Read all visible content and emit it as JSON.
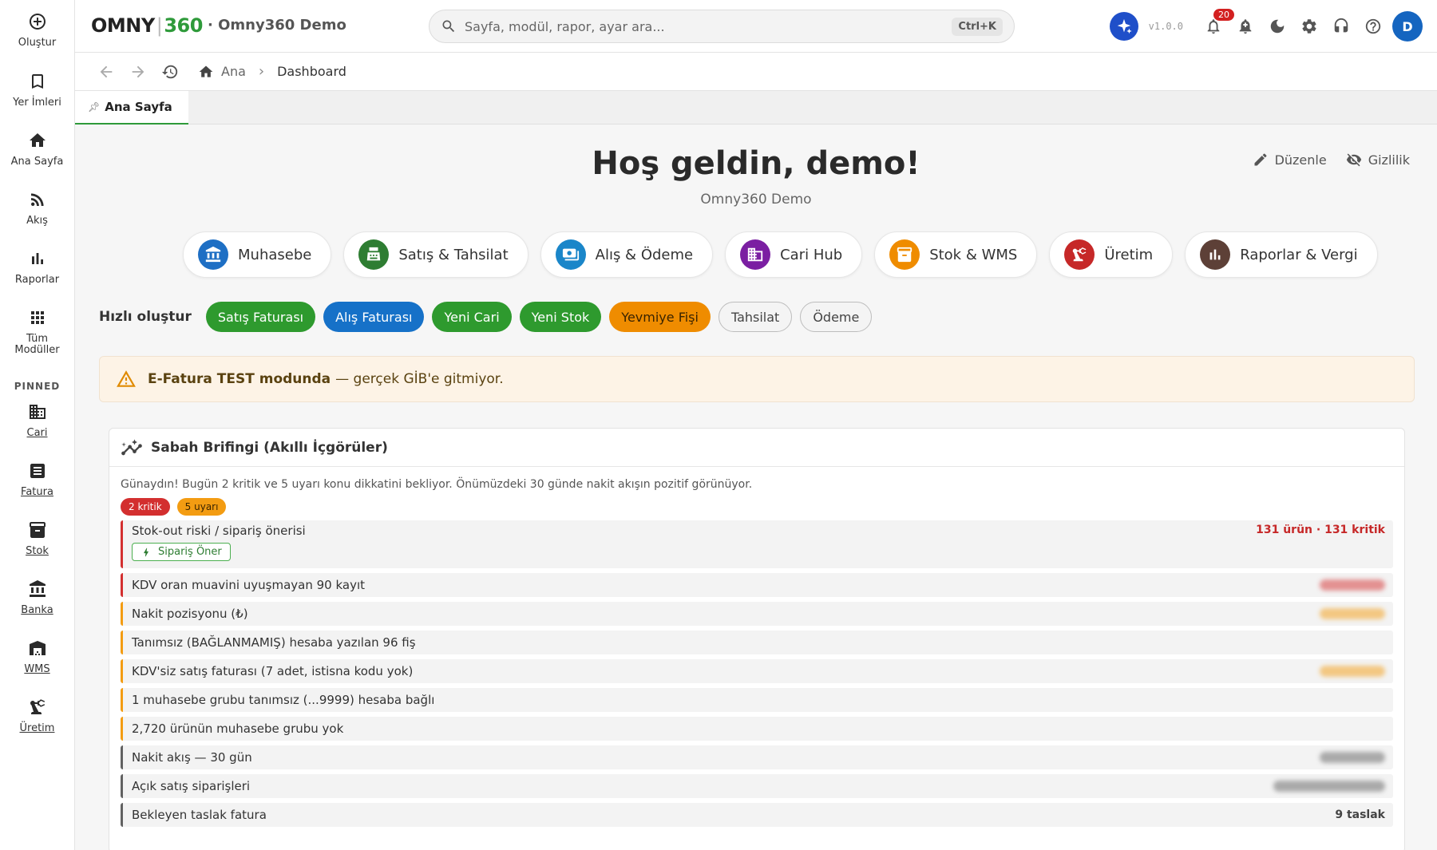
{
  "rail": {
    "items": [
      {
        "label": "Oluştur",
        "icon": "add-circle-icon"
      },
      {
        "label": "Yer İmleri",
        "icon": "bookmark-icon"
      },
      {
        "label": "Ana Sayfa",
        "icon": "home-icon"
      },
      {
        "label": "Akış",
        "icon": "rss-feed-icon"
      },
      {
        "label": "Raporlar",
        "icon": "bar-chart-icon"
      },
      {
        "label": "Tüm Modüller",
        "icon": "apps-grid-icon"
      }
    ],
    "pinned_title": "PINNED",
    "pinned": [
      {
        "label": "Cari",
        "icon": "domain-icon"
      },
      {
        "label": "Fatura",
        "icon": "receipt-icon"
      },
      {
        "label": "Stok",
        "icon": "inventory-icon"
      },
      {
        "label": "Banka",
        "icon": "bank-icon"
      },
      {
        "label": "WMS",
        "icon": "warehouse-icon"
      },
      {
        "label": "Üretim",
        "icon": "precision-manufacturing-icon"
      }
    ]
  },
  "topbar": {
    "brand_a": "OMNY",
    "brand_sep": "|",
    "brand_b": "360",
    "org": "· Omny360 Demo",
    "search_placeholder": "Sayfa, modül, rapor, ayar ara...",
    "search_shortcut": "Ctrl+K",
    "version": "v1.0.0",
    "notifications_count": "20",
    "avatar": "D",
    "colors": {
      "brand_green": "#2e9a3a",
      "ai_blue": "#1f4fc9",
      "avatar_blue": "#1565c0",
      "badge_red": "#d32020"
    }
  },
  "breadcrumb": {
    "home": "Ana",
    "current": "Dashboard"
  },
  "tabs": [
    {
      "label": "Ana Sayfa",
      "active": true
    }
  ],
  "main": {
    "welcome": "Hoş geldin, demo!",
    "subtitle": "Omny360 Demo",
    "edit_label": "Düzenle",
    "privacy_label": "Gizlilik",
    "modules": [
      {
        "label": "Muhasebe",
        "color": "#1e6fc4",
        "icon": "bank-icon"
      },
      {
        "label": "Satış & Tahsilat",
        "color": "#2e7d32",
        "icon": "cash-register-icon"
      },
      {
        "label": "Alış & Ödeme",
        "color": "#1a86c9",
        "icon": "payments-icon"
      },
      {
        "label": "Cari Hub",
        "color": "#7b1fa2",
        "icon": "domain-icon"
      },
      {
        "label": "Stok & WMS",
        "color": "#ef8c00",
        "icon": "inventory-icon"
      },
      {
        "label": "Üretim",
        "color": "#c62828",
        "icon": "precision-manufacturing-icon"
      },
      {
        "label": "Raporlar & Vergi",
        "color": "#5d4037",
        "icon": "bar-chart-icon"
      }
    ],
    "quick_label": "Hızlı oluştur",
    "quick": [
      {
        "label": "Satış Faturası",
        "color": "#2e9a2e",
        "style": "filled"
      },
      {
        "label": "Alış Faturası",
        "color": "#1671c8",
        "style": "filled"
      },
      {
        "label": "Yeni Cari",
        "color": "#2e9a2e",
        "style": "filled"
      },
      {
        "label": "Yeni Stok",
        "color": "#2e9a2e",
        "style": "filled"
      },
      {
        "label": "Yevmiye Fişi",
        "color": "#ef8c00",
        "style": "filled",
        "text_color": "#3a2400"
      },
      {
        "label": "Tahsilat",
        "style": "outline"
      },
      {
        "label": "Ödeme",
        "style": "outline"
      }
    ],
    "alert": {
      "strong": "E-Fatura TEST modunda",
      "rest": "— gerçek GİB'e gitmiyor."
    }
  },
  "briefing": {
    "title": "Sabah Brifingi (Akıllı İçgörüler)",
    "summary": "Günaydın! Bugün 2 kritik ve 5 uyarı konu dikkatini bekliyor. Önümüzdeki 30 günde nakit akışın pozitif görünüyor.",
    "pills": [
      {
        "label": "2 kritik",
        "bg": "#d32f2f",
        "fg": "#ffffff"
      },
      {
        "label": "5 uyarı",
        "bg": "#f39c12",
        "fg": "#3a2400"
      }
    ],
    "rows": [
      {
        "label": "Stok-out riski / sipariş önerisi",
        "value": "131 ürün · 131 kritik",
        "level": "critical",
        "action": "Sipariş Öner"
      },
      {
        "label": "KDV oran muavini uyuşmayan 90 kayıt",
        "level": "critical",
        "blurred": true
      },
      {
        "label": "Nakit pozisyonu (₺)",
        "level": "warning",
        "blurred": true
      },
      {
        "label": "Tanımsız (BAĞLANMAMIŞ) hesaba yazılan 96 fiş",
        "level": "warning"
      },
      {
        "label": "KDV'siz satış faturası (7 adet, istisna kodu yok)",
        "level": "warning",
        "blurred": true
      },
      {
        "label": "1 muhasebe grubu tanımsız (...9999) hesaba bağlı",
        "level": "warning"
      },
      {
        "label": "2,720 ürünün muhasebe grubu yok",
        "level": "warning"
      },
      {
        "label": "Nakit akış — 30 gün",
        "level": "info",
        "blurred": true
      },
      {
        "label": "Açık satış siparişleri",
        "level": "info",
        "blurred": true
      },
      {
        "label": "Bekleyen taslak fatura",
        "value": "9 taslak",
        "level": "info"
      }
    ],
    "level_colors": {
      "critical": "#d32f2f",
      "warning": "#f39c12",
      "info": "#616161"
    }
  }
}
